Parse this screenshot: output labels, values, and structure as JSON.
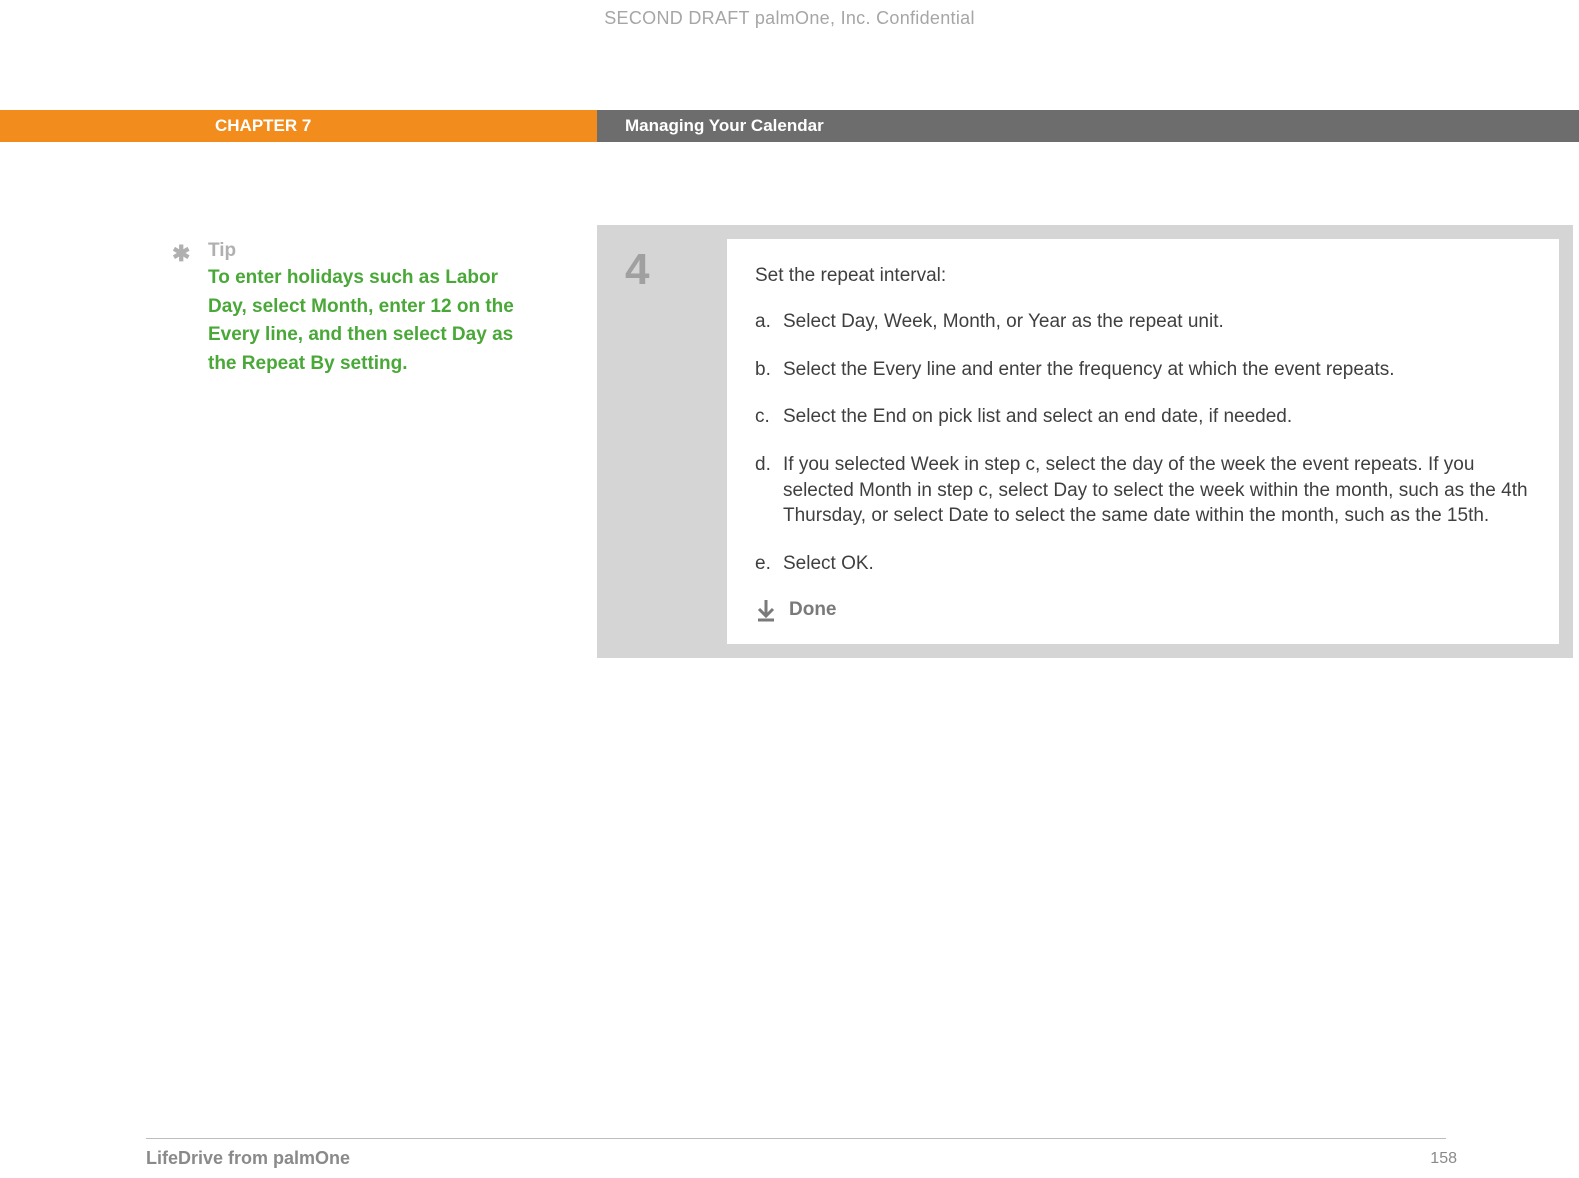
{
  "watermark": "SECOND DRAFT palmOne, Inc.  Confidential",
  "chapter": {
    "number": "CHAPTER 7",
    "title": "Managing Your Calendar"
  },
  "tip": {
    "label": "Tip",
    "body": "To enter holidays such as Labor Day, select Month, enter 12 on the Every line, and then select Day as the Repeat By setting."
  },
  "step": {
    "number": "4",
    "intro": "Set the repeat interval:",
    "items": [
      {
        "letter": "a.",
        "text": "Select Day, Week, Month, or Year as the repeat unit."
      },
      {
        "letter": "b.",
        "text": "Select the Every line and enter the frequency at which the event repeats."
      },
      {
        "letter": "c.",
        "text": "Select the End on pick list and select an end date, if needed."
      },
      {
        "letter": "d.",
        "text": "If you selected Week in step c, select the day of the week the event repeats. If you selected Month in step c, select Day to select the week within the month, such as the 4th Thursday, or select Date to select the same date within the month, such as the 15th."
      },
      {
        "letter": "e.",
        "text": "Select OK."
      }
    ],
    "done": "Done"
  },
  "footer": {
    "title": "LifeDrive from palmOne",
    "page": "158"
  }
}
